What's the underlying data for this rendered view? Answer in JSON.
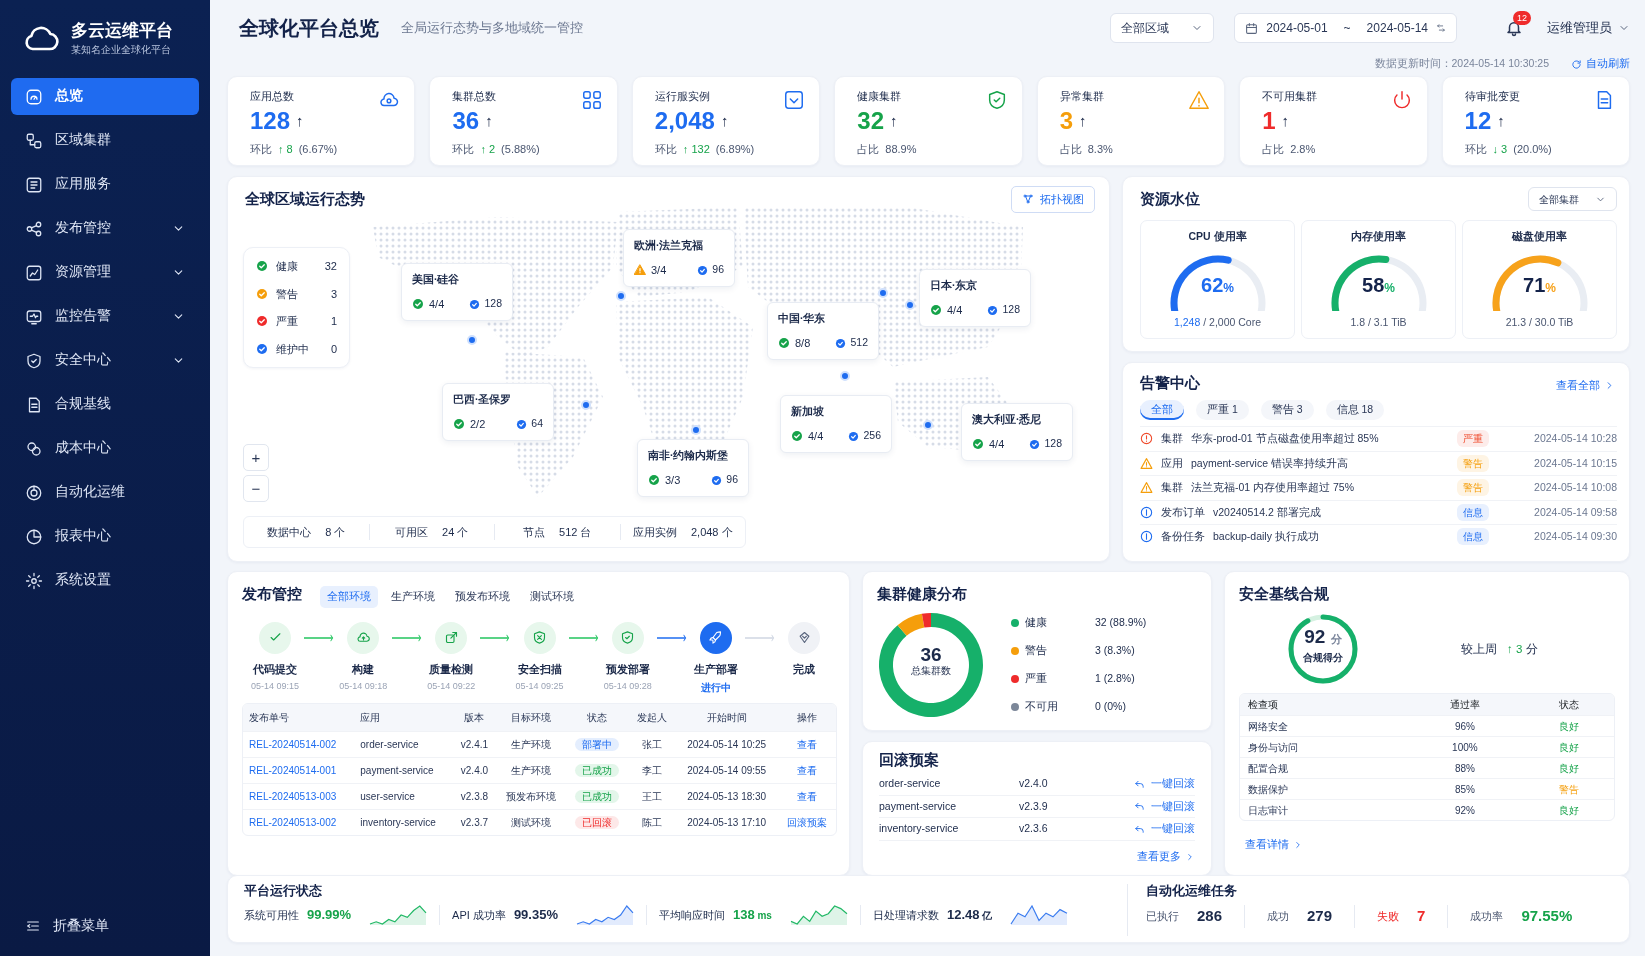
{
  "brand": {
    "name": "多云运维平台",
    "subtitle": "某知名企业全球化平台"
  },
  "sidebar": {
    "items": [
      {
        "label": "总览",
        "selected": true,
        "has_submenu": false
      },
      {
        "label": "区域集群",
        "selected": false,
        "has_submenu": false
      },
      {
        "label": "应用服务",
        "selected": false,
        "has_submenu": false
      },
      {
        "label": "发布管控",
        "selected": false,
        "has_submenu": true
      },
      {
        "label": "资源管理",
        "selected": false,
        "has_submenu": true
      },
      {
        "label": "监控告警",
        "selected": false,
        "has_submenu": true
      },
      {
        "label": "安全中心",
        "selected": false,
        "has_submenu": true
      },
      {
        "label": "合规基线",
        "selected": false,
        "has_submenu": false
      },
      {
        "label": "成本中心",
        "selected": false,
        "has_submenu": false
      },
      {
        "label": "自动化运维",
        "selected": false,
        "has_submenu": false
      },
      {
        "label": "报表中心",
        "selected": false,
        "has_submenu": false
      },
      {
        "label": "系统设置",
        "selected": false,
        "has_submenu": false
      }
    ],
    "collapse": "折叠菜单"
  },
  "header": {
    "title": "全球化平台总览",
    "subtitle": "全局运行态势与多地域统一管控",
    "region_select": "全部区域",
    "date_from": "2024-05-01",
    "date_sep": "~",
    "date_to": "2024-05-14",
    "notification_count": "12",
    "user": "运维管理员",
    "updated": "数据更新时间：2024-05-14 10:30:25",
    "auto_refresh": "自动刷新"
  },
  "kpis": [
    {
      "label": "应用总数",
      "value": "128",
      "value_arrow": "↑",
      "color": "#1e6cf0",
      "footer_label": "环比",
      "delta": "↑ 8",
      "footer_value": "(6.67%)"
    },
    {
      "label": "集群总数",
      "value": "36",
      "value_arrow": "↑",
      "color": "#1e6cf0",
      "footer_label": "环比",
      "delta": "↑ 2",
      "footer_value": "(5.88%)"
    },
    {
      "label": "运行服实例",
      "value": "2,048",
      "value_arrow": "↑",
      "color": "#1e6cf0",
      "footer_label": "环比",
      "delta": "↑ 132",
      "footer_value": "(6.89%)"
    },
    {
      "label": "健康集群",
      "value": "32",
      "value_arrow": "↑",
      "color": "#16a34a",
      "footer_label": "占比",
      "footer_value": "88.9%"
    },
    {
      "label": "异常集群",
      "value": "3",
      "value_arrow": "↑",
      "color": "#f59e0b",
      "footer_label": "占比",
      "footer_value": "8.3%"
    },
    {
      "label": "不可用集群",
      "value": "1",
      "value_arrow": "↑",
      "color": "#ef2b2b",
      "footer_label": "占比",
      "footer_value": "2.8%"
    },
    {
      "label": "待审批变更",
      "value": "12",
      "value_arrow": "↑",
      "color": "#1e6cf0",
      "footer_label": "环比",
      "delta": "↓ 3",
      "footer_value": "(20.0%)"
    }
  ],
  "map": {
    "title": "全球区域运行态势",
    "topology_button": "拓扑视图",
    "zoom_in": "+",
    "zoom_out": "−",
    "legend": [
      {
        "label": "健康",
        "count": "32",
        "color": "#16a34a"
      },
      {
        "label": "警告",
        "count": "3",
        "color": "#f59e0b"
      },
      {
        "label": "严重",
        "count": "1",
        "color": "#ef2b2b"
      },
      {
        "label": "维护中",
        "count": "0",
        "color": "#1e6cf0"
      }
    ],
    "regions": [
      {
        "name": "欧洲·法兰克福",
        "kind": "warning",
        "clusters": "3/4",
        "instances": "96"
      },
      {
        "name": "美国·硅谷",
        "kind": "healthy",
        "clusters": "4/4",
        "instances": "128"
      },
      {
        "name": "日本·东京",
        "kind": "healthy",
        "clusters": "4/4",
        "instances": "128"
      },
      {
        "name": "中国·华东",
        "kind": "healthy",
        "clusters": "8/8",
        "instances": "512"
      },
      {
        "name": "巴西·圣保罗",
        "kind": "healthy",
        "clusters": "2/2",
        "instances": "64"
      },
      {
        "name": "新加坡",
        "kind": "healthy",
        "clusters": "4/4",
        "instances": "256"
      },
      {
        "name": "澳大利亚·悉尼",
        "kind": "healthy",
        "clusters": "4/4",
        "instances": "128"
      },
      {
        "name": "南非·约翰内斯堡",
        "kind": "healthy",
        "clusters": "3/3",
        "instances": "96"
      }
    ],
    "stats": [
      {
        "label": "数据中心",
        "value": "8",
        "unit": "个"
      },
      {
        "label": "可用区",
        "value": "24",
        "unit": "个"
      },
      {
        "label": "节点",
        "value": "512",
        "unit": "台"
      },
      {
        "label": "应用实例",
        "value": "2,048",
        "unit": "个"
      }
    ]
  },
  "resources": {
    "title": "资源水位",
    "filter": "全部集群",
    "gauges": [
      {
        "label": "CPU 使用率",
        "value": "62",
        "unit": "%",
        "level": 0.62,
        "color": "#1e6cf0",
        "highlight": true,
        "used": "1,248",
        "detail": "/ 2,000 Core"
      },
      {
        "label": "内存使用率",
        "value": "58",
        "unit": "%",
        "level": 0.58,
        "color": "#16b06a",
        "highlight": false,
        "detail": "1.8 / 3.1 TiB"
      },
      {
        "label": "磁盘使用率",
        "value": "71",
        "unit": "%",
        "level": 0.71,
        "color": "#f7a21b",
        "highlight": false,
        "detail": "21.3 / 30.0 TiB"
      }
    ]
  },
  "alerts": {
    "title": "告警中心",
    "view_all": "查看全部",
    "tabs": [
      {
        "label": "全部",
        "selected": true
      },
      {
        "label": "严重 1",
        "selected": false
      },
      {
        "label": "警告 3",
        "selected": false
      },
      {
        "label": "信息 18",
        "selected": false
      }
    ],
    "items": [
      {
        "kind": "critical",
        "category": "集群",
        "message": "华东-prod-01 节点磁盘使用率超过 85%",
        "tag": "严重",
        "time": "2024-05-14 10:28"
      },
      {
        "kind": "warning",
        "category": "应用",
        "message": "payment-service 错误率持续升高",
        "tag": "警告",
        "time": "2024-05-14 10:15"
      },
      {
        "kind": "warning",
        "category": "集群",
        "message": "法兰克福-01 内存使用率超过 75%",
        "tag": "警告",
        "time": "2024-05-14 10:08"
      },
      {
        "kind": "info",
        "category": "发布订单",
        "message": "v20240514.2 部署完成",
        "tag": "信息",
        "time": "2024-05-14 09:58"
      },
      {
        "kind": "info",
        "category": "备份任务",
        "message": "backup-daily 执行成功",
        "tag": "信息",
        "time": "2024-05-14 09:30"
      }
    ]
  },
  "release": {
    "title": "发布管控",
    "tabs": [
      {
        "label": "全部环境",
        "selected": true
      },
      {
        "label": "生产环境",
        "selected": false
      },
      {
        "label": "预发布环境",
        "selected": false
      },
      {
        "label": "测试环境",
        "selected": false
      }
    ],
    "steps": [
      {
        "label": "代码提交",
        "time": "05-14 09:15",
        "kind": "done"
      },
      {
        "label": "构建",
        "time": "05-14 09:18",
        "kind": "done"
      },
      {
        "label": "质量检测",
        "time": "05-14 09:22",
        "kind": "done"
      },
      {
        "label": "安全扫描",
        "time": "05-14 09:25",
        "kind": "done"
      },
      {
        "label": "预发部署",
        "time": "05-14 09:28",
        "kind": "done"
      },
      {
        "label": "生产部署",
        "time": "进行中",
        "kind": "active"
      },
      {
        "label": "完成",
        "kind": "pending"
      }
    ],
    "table": {
      "columns": [
        "发布单号",
        "应用",
        "版本",
        "目标环境",
        "状态",
        "发起人",
        "开始时间",
        "操作"
      ],
      "rows": [
        {
          "id": "REL-20240514-002",
          "app": "order-service",
          "version": "v2.4.1",
          "env": "生产环境",
          "status": "部署中",
          "kind": "running",
          "owner": "张工",
          "start": "2024-05-14 10:25",
          "action": "查看"
        },
        {
          "id": "REL-20240514-001",
          "app": "payment-service",
          "version": "v2.4.0",
          "env": "生产环境",
          "status": "已成功",
          "kind": "success",
          "owner": "李工",
          "start": "2024-05-14 09:55",
          "action": "查看"
        },
        {
          "id": "REL-20240513-003",
          "app": "user-service",
          "version": "v2.3.8",
          "env": "预发布环境",
          "status": "已成功",
          "kind": "success",
          "owner": "王工",
          "start": "2024-05-13 18:30",
          "action": "查看"
        },
        {
          "id": "REL-20240513-002",
          "app": "inventory-service",
          "version": "v2.3.7",
          "env": "测试环境",
          "status": "已回滚",
          "kind": "rolledback",
          "owner": "陈工",
          "start": "2024-05-13 17:10",
          "action": "回滚预案"
        }
      ]
    }
  },
  "health": {
    "title": "集群健康分布",
    "total": "36",
    "total_label": "总集群数",
    "legend": [
      {
        "count": "32",
        "pct": "(88.9%)",
        "color": "#16b06a"
      },
      {
        "count": "3",
        "pct": "(8.3%)",
        "color": "#f59e0b"
      },
      {
        "count": "1",
        "pct": "(2.8%)",
        "color": "#ef2b2b"
      },
      {
        "count": "0",
        "pct": "(0%)",
        "color": "#7c8799"
      }
    ],
    "chart_data": {
      "type": "donut",
      "categories": [
        "健康",
        "警告",
        "严重",
        "不可用"
      ],
      "values": [
        88.9,
        8.3,
        2.8,
        0
      ]
    }
  },
  "rollback": {
    "title": "回滚预案",
    "items": [
      {
        "service": "order-service",
        "version": "v2.4.0",
        "action": "一键回滚"
      },
      {
        "service": "payment-service",
        "version": "v2.3.9",
        "action": "一键回滚"
      },
      {
        "service": "inventory-service",
        "version": "v2.3.6",
        "action": "一键回滚"
      }
    ],
    "more": "查看更多"
  },
  "security": {
    "title": "安全基线合规",
    "score": "92",
    "score_unit": "分",
    "score_label": "合规得分",
    "compare_label": "较上周",
    "compare_value": "↑ 3",
    "compare_unit": "分",
    "columns": [
      "检查项",
      "通过率",
      "状态"
    ],
    "rows": [
      {
        "item": "网络安全",
        "rate": "96%",
        "status": "良好",
        "kind": "good"
      },
      {
        "item": "身份与访问",
        "rate": "100%",
        "status": "良好",
        "kind": "good"
      },
      {
        "item": "配置合规",
        "rate": "88%",
        "status": "良好",
        "kind": "good"
      },
      {
        "item": "数据保护",
        "rate": "85%",
        "status": "警告",
        "kind": "warn"
      },
      {
        "item": "日志审计",
        "rate": "92%",
        "status": "良好",
        "kind": "good"
      }
    ],
    "details": "查看详情"
  },
  "platform_status": {
    "title": "平台运行状态",
    "metrics": [
      {
        "label": "系统可用性",
        "value": "99.99%",
        "kind": "good"
      },
      {
        "label": "API 成功率",
        "value": "99.35%",
        "kind": "neutral"
      },
      {
        "label": "平均响应时间",
        "value": "138",
        "unit": "ms",
        "kind": "good"
      },
      {
        "label": "日处理请求数",
        "value": "12.48",
        "unit": "亿",
        "kind": "neutral"
      }
    ]
  },
  "automation": {
    "title": "自动化运维任务",
    "metrics": [
      {
        "label": "已执行",
        "value": "286",
        "kind": "neutral"
      },
      {
        "label": "成功",
        "value": "279",
        "kind": "neutral"
      },
      {
        "label": "失败",
        "value": "7",
        "kind": "bad"
      },
      {
        "label": "成功率",
        "value": "97.55%",
        "kind": "good"
      }
    ]
  }
}
